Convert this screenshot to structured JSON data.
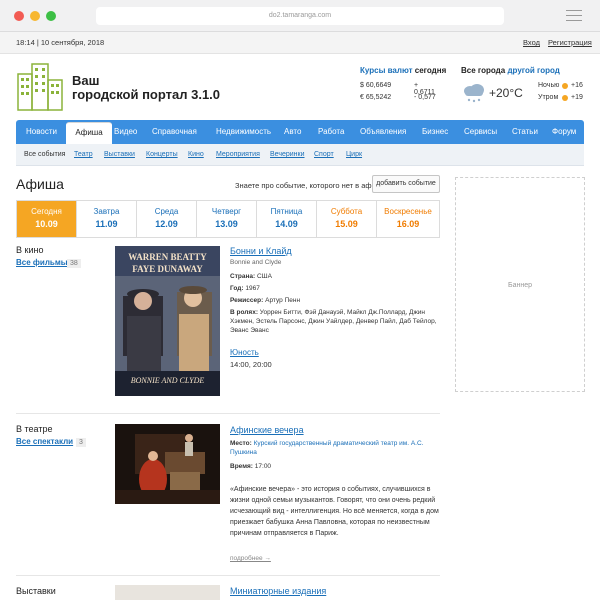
{
  "browser": {
    "url": "do2.tamaranga.com"
  },
  "topbar": {
    "datetime": "18:14 | 10 сентября, 2018",
    "login": "Вход",
    "register": "Регистрация"
  },
  "header": {
    "title_line1": "Ваш",
    "title_line2": "городской портал 3.1.0",
    "rates": {
      "link": "Курсы валют",
      "today": "сегодня",
      "rows": [
        {
          "symbol": "$",
          "value": "60,6649",
          "change": "+ 0,6711"
        },
        {
          "symbol": "€",
          "value": "65,5242",
          "change": "- 0,577"
        }
      ]
    },
    "weather": {
      "all_cities": "Все города",
      "other_city": "другой город",
      "temp": "+20°C",
      "night_label": "Ночью",
      "night_temp": "+16",
      "morning_label": "Утром",
      "morning_temp": "+19"
    }
  },
  "nav": {
    "items": [
      "Новости",
      "Афиша",
      "Видео",
      "Справочная",
      "Недвижимость",
      "Авто",
      "Работа",
      "Объявления",
      "Бизнес",
      "Сервисы",
      "Статьи",
      "Форум"
    ],
    "active": "Афиша"
  },
  "subnav": {
    "items": [
      "Все события",
      "Театр",
      "Выставки",
      "Концерты",
      "Кино",
      "Мероприятия",
      "Вечеринки",
      "Спорт",
      "Цирк"
    ]
  },
  "afisha": {
    "title": "Афиша",
    "question": "Знаете про событие, которого нет в афише?",
    "add_button": "добавить событие",
    "days": [
      {
        "name": "Сегодня",
        "date": "10.09",
        "state": "active"
      },
      {
        "name": "Завтра",
        "date": "11.09",
        "state": "normal"
      },
      {
        "name": "Среда",
        "date": "12.09",
        "state": "normal"
      },
      {
        "name": "Четверг",
        "date": "13.09",
        "state": "normal"
      },
      {
        "name": "Пятница",
        "date": "14.09",
        "state": "normal"
      },
      {
        "name": "Суббота",
        "date": "15.09",
        "state": "weekend"
      },
      {
        "name": "Воскресенье",
        "date": "16.09",
        "state": "weekend"
      }
    ]
  },
  "banner": {
    "label": "Баннер"
  },
  "cinema": {
    "label": "В кино",
    "all_link": "Все фильмы",
    "count": "38",
    "poster_top1": "WARREN BEATTY",
    "poster_top2": "FAYE DUNAWAY",
    "poster_bottom": "BONNIE AND CLYDE",
    "title": "Бонни и Клайд",
    "original": "Bonnie and Clyde",
    "country_label": "Страна:",
    "country": "США",
    "year_label": "Год:",
    "year": "1967",
    "director_label": "Режиссер:",
    "director": "Артур Пенн",
    "cast_label": "В ролях:",
    "cast": "Уоррен Битти, Фэй Данауэй, Майкл Дж.Поллард, Джин Хэкмен, Эстель Парсонс, Джин Уайлдер, Денвер Пайл, Даб Тейлор, Эванс Эванс",
    "cinema_name": "Юность",
    "times": "14:00, 20:00"
  },
  "theatre": {
    "label": "В театре",
    "all_link": "Все спектакли",
    "count": "3",
    "title": "Афинские вечера",
    "place_label": "Место:",
    "place": "Курский государственный драматический театр им. А.С. Пушкина",
    "time_label": "Время:",
    "time": "17:00",
    "description": "«Афинские вечера» - это история о событиях, случившихся в жизни одной семьи музыкантов. Говорят, что они очень редкий исчезающий вид - интеллигенция. Но всё меняется, когда в дом приезжает бабушка Анна Павловна, которая по неизвестным причинам отправляется в Париж.",
    "more": "подробнее →"
  },
  "exhibitions": {
    "label": "Выставки",
    "title": "Миниатюрные издания"
  },
  "colors": {
    "nav": "#3b8fe0",
    "accent": "#f5a623",
    "weekend": "#f07c00",
    "link": "#1a6fb8"
  }
}
